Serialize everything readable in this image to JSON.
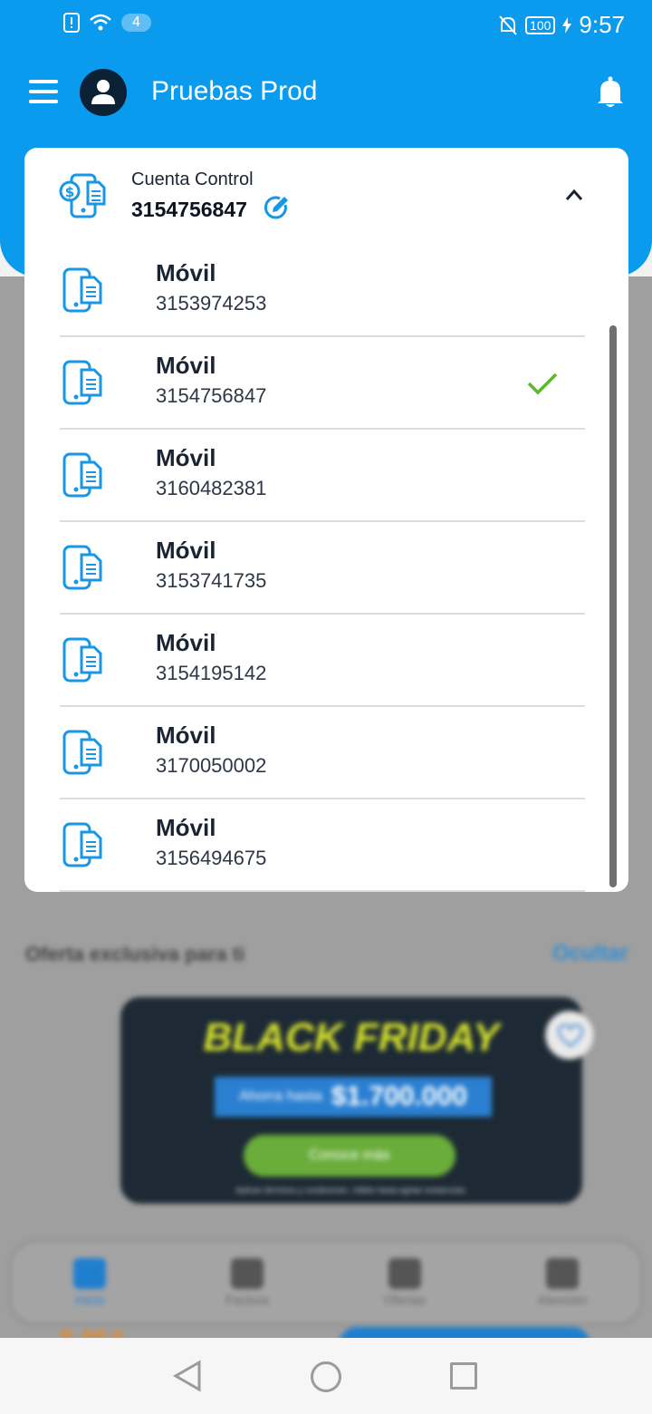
{
  "status_bar": {
    "notification_count": "4",
    "battery": "100",
    "time": "9:57"
  },
  "header": {
    "title": "Pruebas Prod",
    "menu_icon": "hamburger-menu-icon",
    "avatar_icon": "user-icon",
    "bell_icon": "bell-icon"
  },
  "account": {
    "label": "Cuenta Control",
    "number": "3154756847",
    "selected_index": 1
  },
  "lines": [
    {
      "type": "Móvil",
      "number": "3153974253"
    },
    {
      "type": "Móvil",
      "number": "3154756847"
    },
    {
      "type": "Móvil",
      "number": "3160482381"
    },
    {
      "type": "Móvil",
      "number": "3153741735"
    },
    {
      "type": "Móvil",
      "number": "3154195142"
    },
    {
      "type": "Móvil",
      "number": "3170050002"
    },
    {
      "type": "Móvil",
      "number": "3156494675"
    }
  ],
  "offer": {
    "title": "Oferta exclusiva para ti",
    "hide_label": "Ocultar",
    "banner_headline": "BLACK FRIDAY",
    "banner_save_prefix": "Ahorra hasta",
    "banner_save_amount": "$1.700.000",
    "banner_cta": "Conoce más",
    "banner_note": "Aplican términos y condiciones. Válido hasta agotar existencias."
  },
  "bottom_nav": [
    {
      "label": "Inicio",
      "icon": "home-icon"
    },
    {
      "label": "Factura",
      "icon": "invoice-icon"
    },
    {
      "label": "Ofertas",
      "icon": "offers-icon"
    },
    {
      "label": "Atención",
      "icon": "support-icon"
    }
  ],
  "colors": {
    "primary": "#0a9bee",
    "accent_green": "#5cb82f",
    "icon_blue": "#1797e6"
  }
}
